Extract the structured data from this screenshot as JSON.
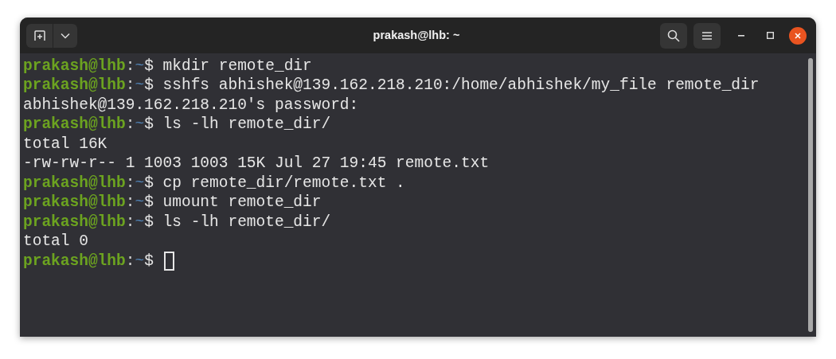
{
  "window": {
    "title": "prakash@lhb: ~"
  },
  "lines": [
    {
      "kind": "prompt",
      "user": "prakash@lhb",
      "separator": ":",
      "path": "~",
      "symbol": "$",
      "command": "mkdir remote_dir"
    },
    {
      "kind": "prompt",
      "user": "prakash@lhb",
      "separator": ":",
      "path": "~",
      "symbol": "$",
      "command": "sshfs abhishek@139.162.218.210:/home/abhishek/my_file remote_dir"
    },
    {
      "kind": "output",
      "text": "abhishek@139.162.218.210's password:"
    },
    {
      "kind": "prompt",
      "user": "prakash@lhb",
      "separator": ":",
      "path": "~",
      "symbol": "$",
      "command": "ls -lh remote_dir/"
    },
    {
      "kind": "output",
      "text": "total 16K"
    },
    {
      "kind": "output",
      "text": "-rw-rw-r-- 1 1003 1003 15K Jul 27 19:45 remote.txt"
    },
    {
      "kind": "prompt",
      "user": "prakash@lhb",
      "separator": ":",
      "path": "~",
      "symbol": "$",
      "command": "cp remote_dir/remote.txt ."
    },
    {
      "kind": "prompt",
      "user": "prakash@lhb",
      "separator": ":",
      "path": "~",
      "symbol": "$",
      "command": "umount remote_dir"
    },
    {
      "kind": "prompt",
      "user": "prakash@lhb",
      "separator": ":",
      "path": "~",
      "symbol": "$",
      "command": "ls -lh remote_dir/"
    },
    {
      "kind": "output",
      "text": "total 0"
    },
    {
      "kind": "current",
      "user": "prakash@lhb",
      "separator": ":",
      "path": "~",
      "symbol": "$"
    }
  ]
}
